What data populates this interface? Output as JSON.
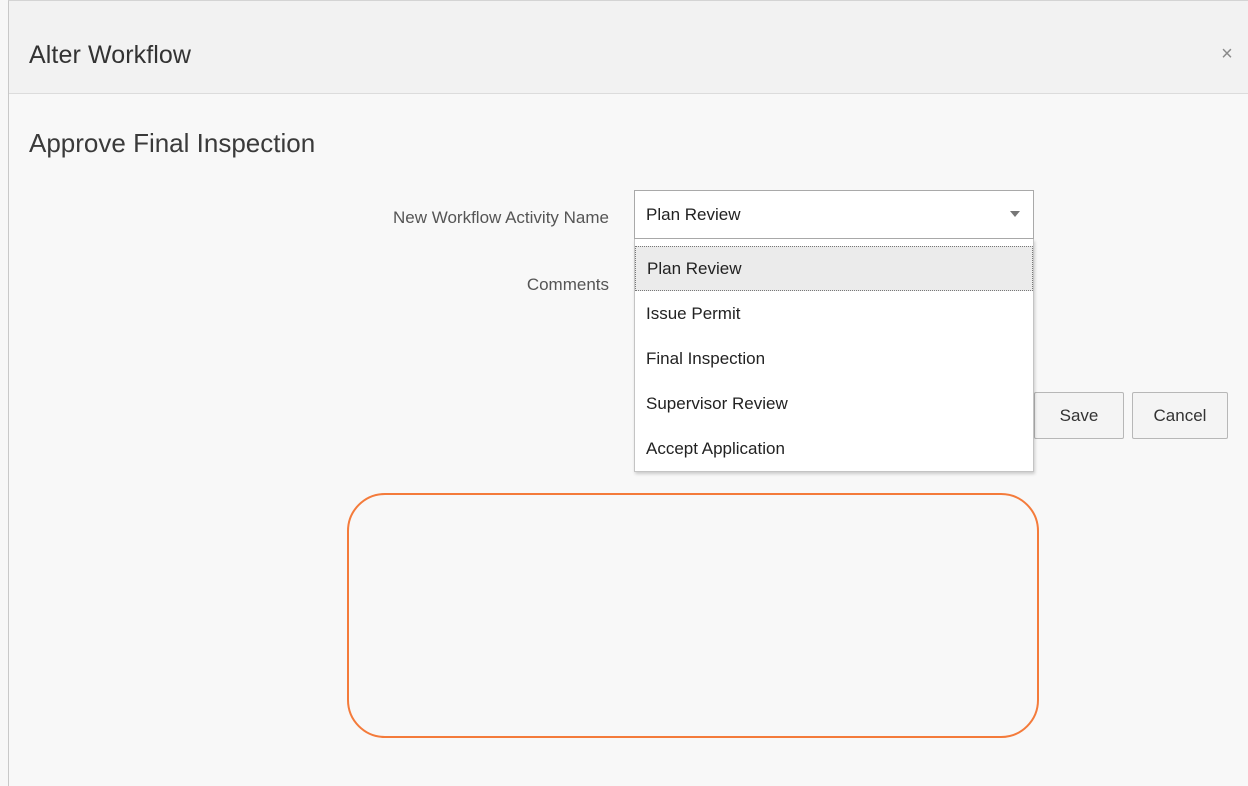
{
  "dialog": {
    "title": "Alter Workflow",
    "close_label": "×"
  },
  "main": {
    "heading": "Approve Final Inspection",
    "activity_label": "New Workflow Activity Name",
    "comments_label": "Comments",
    "select": {
      "value": "Plan Review",
      "icon": "chevron-down-icon"
    },
    "dropdown_options": [
      {
        "label": "Plan Review",
        "selected": true
      },
      {
        "label": "Issue Permit",
        "selected": false
      },
      {
        "label": "Final Inspection",
        "selected": false
      },
      {
        "label": "Supervisor Review",
        "selected": false
      },
      {
        "label": "Accept Application",
        "selected": false
      }
    ],
    "save_label": "Save",
    "cancel_label": "Cancel"
  },
  "colors": {
    "highlight_border": "#f47b3b",
    "selected_option_bg": "#ebebeb"
  }
}
